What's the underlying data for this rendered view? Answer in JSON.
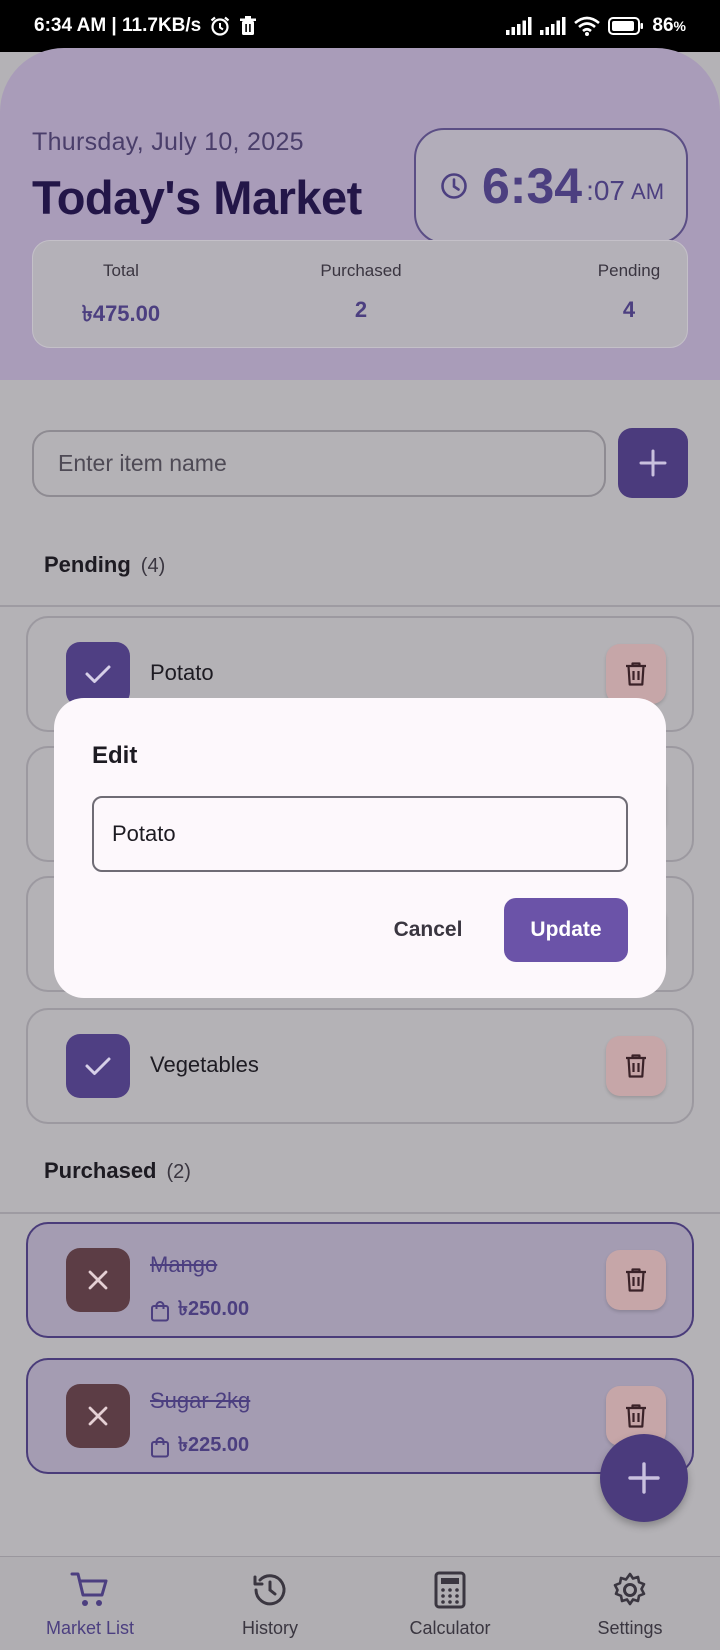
{
  "status_bar": {
    "left_text": "6:34 AM | 11.7KB/s",
    "battery": "86"
  },
  "header": {
    "date": "Thursday, July 10, 2025",
    "title": "Today's Market",
    "clock": {
      "hm": "6:34",
      "sec": ":07",
      "ampm": "AM"
    }
  },
  "summary": {
    "total_label": "Total",
    "total_value": "৳475.00",
    "purchased_label": "Purchased",
    "purchased_value": "2",
    "pending_label": "Pending",
    "pending_value": "4"
  },
  "add_item": {
    "placeholder": "Enter item name"
  },
  "pending_section": {
    "title": "Pending",
    "count": "(4)",
    "items": [
      {
        "name": "Potato"
      },
      {
        "name": ""
      },
      {
        "name": ""
      },
      {
        "name": "Vegetables"
      }
    ]
  },
  "purchased_section": {
    "title": "Purchased",
    "count": "(2)",
    "items": [
      {
        "name": "Mango",
        "price": "৳250.00"
      },
      {
        "name": "Sugar 2kg",
        "price": "৳225.00"
      }
    ]
  },
  "bottom_nav": [
    {
      "label": "Market List",
      "icon": "cart-icon",
      "active": true
    },
    {
      "label": "History",
      "icon": "history-icon",
      "active": false
    },
    {
      "label": "Calculator",
      "icon": "calculator-icon",
      "active": false
    },
    {
      "label": "Settings",
      "icon": "gear-icon",
      "active": false
    }
  ],
  "dialog": {
    "title": "Edit",
    "input_value": "Potato",
    "cancel_label": "Cancel",
    "update_label": "Update"
  },
  "colors": {
    "primary": "#4b3b7d",
    "header_bg": "#a99cb9",
    "scrim_bg": "#b4b2b6",
    "dialog_bg": "#fdf8fc",
    "update_button": "#6b53a8"
  }
}
